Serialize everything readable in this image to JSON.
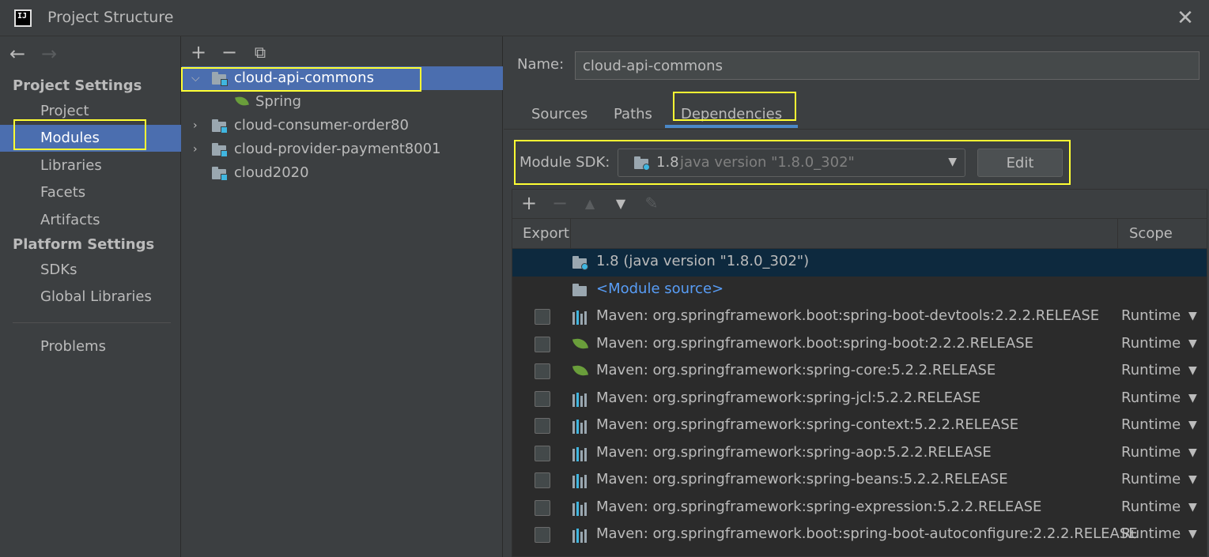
{
  "window": {
    "title": "Project Structure",
    "logo_text": "IJ",
    "close_glyph": "✕"
  },
  "sidebar": {
    "back_glyph": "←",
    "forward_glyph": "→",
    "project_settings_heading": "Project Settings",
    "project_items": [
      "Project",
      "Modules",
      "Libraries",
      "Facets",
      "Artifacts"
    ],
    "platform_settings_heading": "Platform Settings",
    "platform_items": [
      "SDKs",
      "Global Libraries"
    ],
    "problems": "Problems",
    "selected": "Modules"
  },
  "tree_toolbar": {
    "add": "+",
    "remove": "−",
    "copy": "⧉"
  },
  "tree": [
    {
      "label": "cloud-api-commons",
      "expanded": true,
      "selected": true,
      "type": "module"
    },
    {
      "label": "Spring",
      "type": "facet"
    },
    {
      "label": "cloud-consumer-order80",
      "expanded": false,
      "type": "module"
    },
    {
      "label": "cloud-provider-payment8001",
      "expanded": false,
      "type": "module"
    },
    {
      "label": "cloud2020",
      "type": "module"
    }
  ],
  "module": {
    "name_label": "Name:",
    "name_value": "cloud-api-commons",
    "tabs": [
      "Sources",
      "Paths",
      "Dependencies"
    ],
    "active_tab": "Dependencies",
    "sdk_label": "Module SDK:",
    "sdk_version": "1.8",
    "sdk_detail": "java version \"1.8.0_302\"",
    "edit_button": "Edit"
  },
  "deps_toolbar": {
    "add": "+",
    "remove": "−",
    "up": "▲",
    "down": "▼",
    "edit": "✎"
  },
  "deps_columns": {
    "export": "Export",
    "scope": "Scope"
  },
  "dependencies": [
    {
      "label": "1.8 (java version \"1.8.0_302\")",
      "icon": "sdk-folder-icon",
      "selected": true,
      "checkbox": false,
      "scope": ""
    },
    {
      "label": "<Module source>",
      "icon": "module-source-icon",
      "checkbox": false,
      "scope": "",
      "link": true
    },
    {
      "label": "Maven: org.springframework.boot:spring-boot-devtools:2.2.2.RELEASE",
      "icon": "maven-library-icon",
      "checkbox": true,
      "scope": "Runtime"
    },
    {
      "label": "Maven: org.springframework.boot:spring-boot:2.2.2.RELEASE",
      "icon": "spring-boot-icon",
      "checkbox": true,
      "scope": "Runtime"
    },
    {
      "label": "Maven: org.springframework:spring-core:5.2.2.RELEASE",
      "icon": "spring-leaf-icon",
      "checkbox": true,
      "scope": "Runtime"
    },
    {
      "label": "Maven: org.springframework:spring-jcl:5.2.2.RELEASE",
      "icon": "maven-library-icon",
      "checkbox": true,
      "scope": "Runtime"
    },
    {
      "label": "Maven: org.springframework:spring-context:5.2.2.RELEASE",
      "icon": "maven-library-icon",
      "checkbox": true,
      "scope": "Runtime"
    },
    {
      "label": "Maven: org.springframework:spring-aop:5.2.2.RELEASE",
      "icon": "maven-library-icon",
      "checkbox": true,
      "scope": "Runtime"
    },
    {
      "label": "Maven: org.springframework:spring-beans:5.2.2.RELEASE",
      "icon": "maven-library-icon",
      "checkbox": true,
      "scope": "Runtime"
    },
    {
      "label": "Maven: org.springframework:spring-expression:5.2.2.RELEASE",
      "icon": "maven-library-icon",
      "checkbox": true,
      "scope": "Runtime"
    },
    {
      "label": "Maven: org.springframework.boot:spring-boot-autoconfigure:2.2.2.RELEASE",
      "icon": "maven-library-icon",
      "checkbox": true,
      "scope": "Runtime"
    }
  ],
  "dropdown_glyph": "▼",
  "colors": {
    "selection": "#4b6eaf",
    "table_selection": "#0d293e",
    "highlight": "#ffff33",
    "link": "#589df6"
  }
}
